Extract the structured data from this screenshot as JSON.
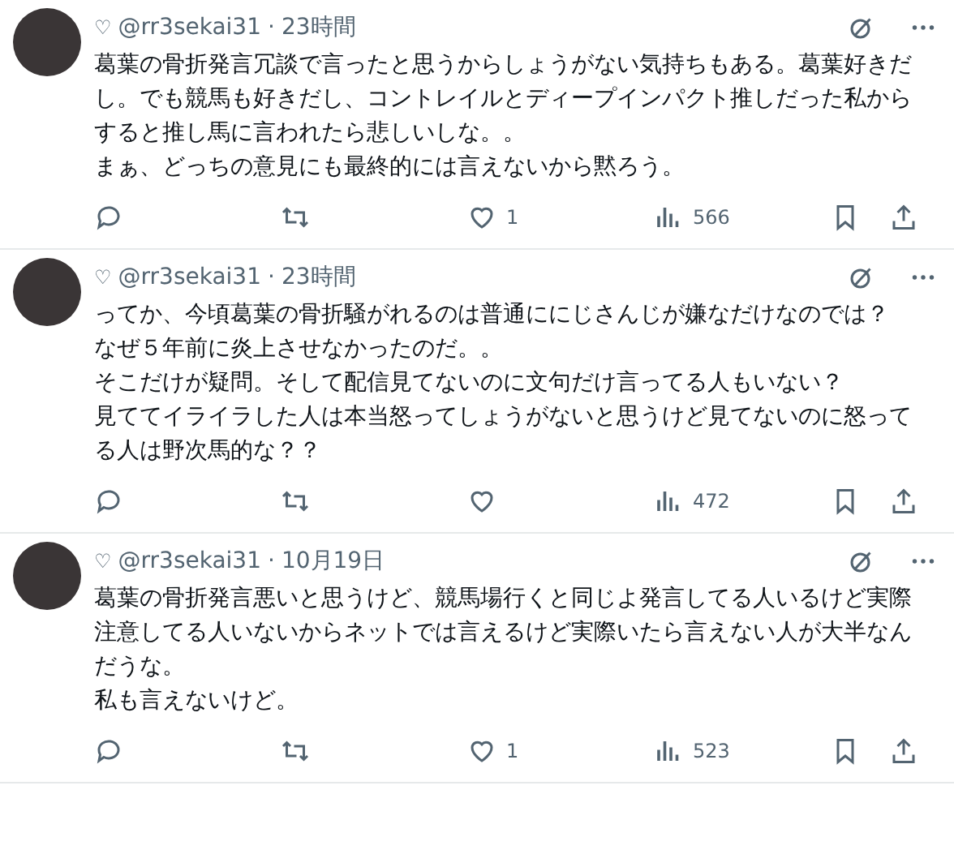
{
  "posts": [
    {
      "name": "♡",
      "handle": "@rr3sekai31",
      "separator": "·",
      "time": "23時間",
      "paragraphs": [
        "葛葉の骨折発言冗談で言ったと思うからしょうがない気持ちもある。葛葉好きだし。でも競馬も好きだし、コントレイルとディープインパクト推しだった私からすると推し馬に言われたら悲しいしな。。",
        "まぁ、どっちの意見にも最終的には言えないから黙ろう。"
      ],
      "likes": "1",
      "views": "566"
    },
    {
      "name": "♡",
      "handle": "@rr3sekai31",
      "separator": "·",
      "time": "23時間",
      "paragraphs": [
        "ってか、今頃葛葉の骨折騒がれるのは普通ににじさんじが嫌なだけなのでは？",
        "なぜ５年前に炎上させなかったのだ。。",
        "そこだけが疑問。そして配信見てないのに文句だけ言ってる人もいない？",
        "見ててイライラした人は本当怒ってしょうがないと思うけど見てないのに怒ってる人は野次馬的な？？"
      ],
      "views": "472"
    },
    {
      "name": "♡",
      "handle": "@rr3sekai31",
      "separator": "·",
      "time": "10月19日",
      "paragraphs": [
        "葛葉の骨折発言悪いと思うけど、競馬場行くと同じよ発言してる人いるけど実際注意してる人いないからネットでは言えるけど実際いたら言えない人が大半なんだうな。",
        "私も言えないけど。"
      ],
      "likes": "1",
      "views": "523"
    }
  ]
}
